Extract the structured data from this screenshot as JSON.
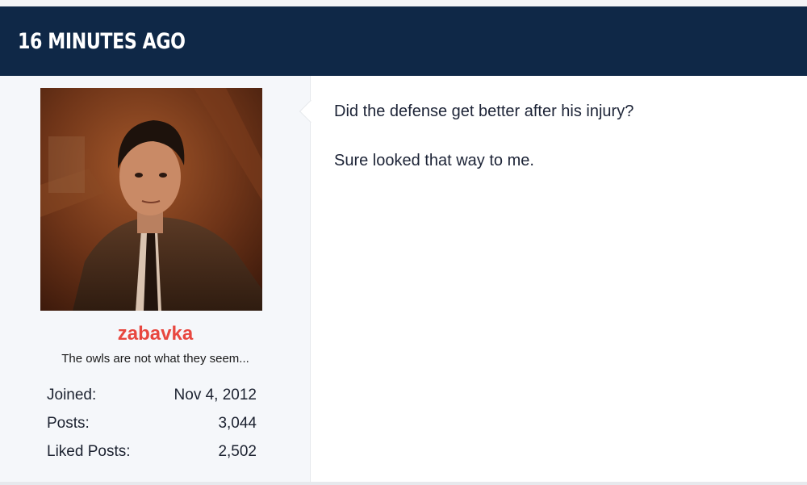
{
  "post": {
    "timestamp": "16 MINUTES AGO",
    "message": {
      "line1": "Did the defense get better after his injury?",
      "line2": "Sure looked that way to me."
    }
  },
  "user": {
    "username": "zabavka",
    "title": "The owls are not what they seem...",
    "stats": [
      {
        "label": "Joined:",
        "value": "Nov 4, 2012"
      },
      {
        "label": "Posts:",
        "value": "3,044"
      },
      {
        "label": "Liked Posts:",
        "value": "2,502"
      }
    ]
  },
  "colors": {
    "header_bg": "#0f2847",
    "username": "#e8473f",
    "sidebar_bg": "#f5f7fa"
  }
}
